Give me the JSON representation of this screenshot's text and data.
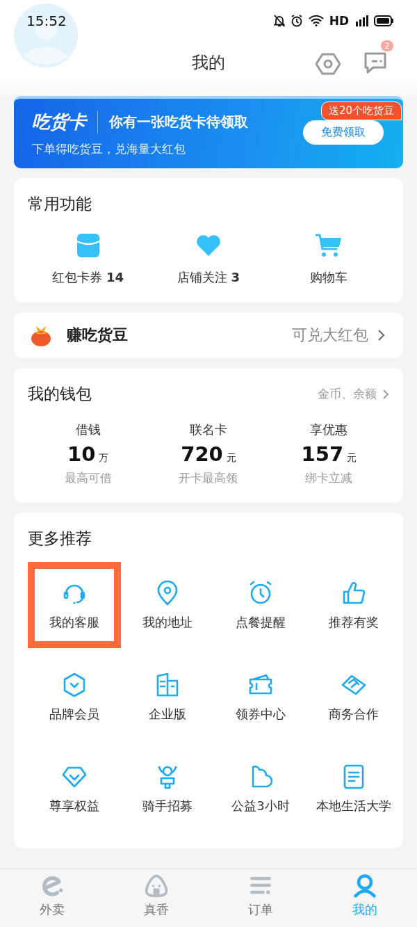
{
  "status_bar": {
    "time": "15:52",
    "network": "HD"
  },
  "header": {
    "title": "我的",
    "message_badge": "2"
  },
  "banner": {
    "logo": "吃货卡",
    "headline": "你有一张吃货卡待领取",
    "subline": "下单得吃货豆，兑海量大红包",
    "tag": "送20个吃货豆",
    "button": "免费领取"
  },
  "shortcuts": {
    "title": "常用功能",
    "items": [
      {
        "label": "红包卡券",
        "count": "14"
      },
      {
        "label": "店铺关注",
        "count": "3"
      },
      {
        "label": "购物车"
      }
    ]
  },
  "beans": {
    "title": "赚吃货豆",
    "link": "可兑大红包"
  },
  "wallet": {
    "title": "我的钱包",
    "link": "金币、余额",
    "items": [
      {
        "label": "借钱",
        "amount": "10",
        "unit": "万",
        "note": "最高可借"
      },
      {
        "label": "联名卡",
        "amount": "720",
        "unit": "元",
        "note": "开卡最高领"
      },
      {
        "label": "享优惠",
        "amount": "157",
        "unit": "元",
        "note": "绑卡立减"
      }
    ]
  },
  "more": {
    "title": "更多推荐",
    "items": [
      {
        "label": "我的客服",
        "highlighted": true
      },
      {
        "label": "我的地址",
        "highlighted": false
      },
      {
        "label": "点餐提醒",
        "highlighted": false
      },
      {
        "label": "推荐有奖",
        "highlighted": false
      },
      {
        "label": "品牌会员",
        "highlighted": false
      },
      {
        "label": "企业版",
        "highlighted": false
      },
      {
        "label": "领券中心",
        "highlighted": false
      },
      {
        "label": "商务合作",
        "highlighted": false
      },
      {
        "label": "尊享权益",
        "highlighted": false
      },
      {
        "label": "骑手招募",
        "highlighted": false
      },
      {
        "label": "公益3小时",
        "highlighted": false
      },
      {
        "label": "本地生活大学",
        "highlighted": false
      }
    ]
  },
  "tab_bar": {
    "tabs": [
      {
        "label": "外卖",
        "selected": false
      },
      {
        "label": "真香",
        "selected": false
      },
      {
        "label": "订单",
        "selected": false
      },
      {
        "label": "我的",
        "selected": true
      }
    ]
  }
}
